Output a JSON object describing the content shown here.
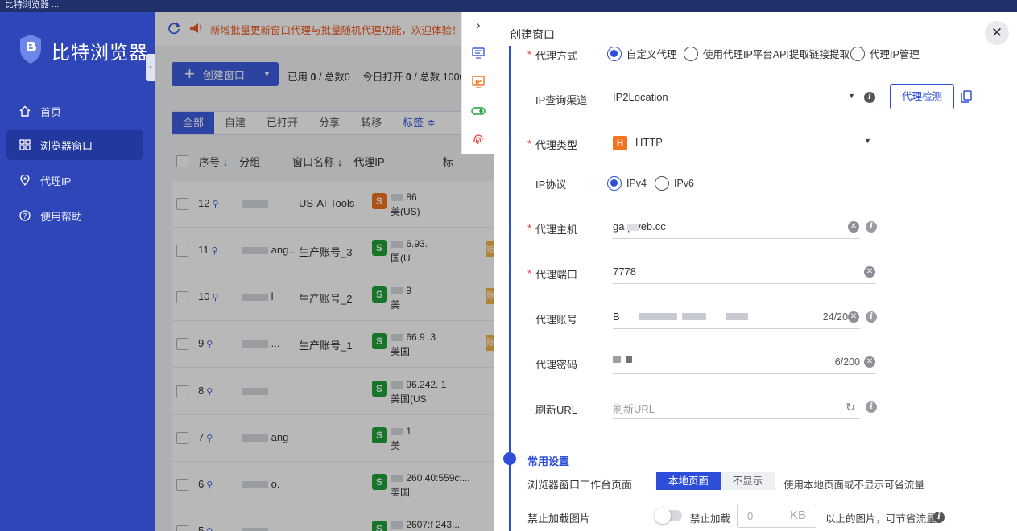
{
  "titlebar": {
    "title": "比特浏览器 ..."
  },
  "sidebar": {
    "brand": "比特浏览器",
    "collapse_glyph": "‹",
    "items": [
      {
        "label": "首页",
        "icon": "home-icon",
        "active": false
      },
      {
        "label": "浏览器窗口",
        "icon": "grid-icon",
        "active": true
      },
      {
        "label": "代理IP",
        "icon": "location-pin-icon",
        "active": false
      },
      {
        "label": "使用帮助",
        "icon": "help-circle-icon",
        "active": false
      }
    ]
  },
  "main": {
    "notice": "新增批量更新窗口代理与批量随机代理功能，欢迎体验！",
    "create_label": "创建窗口",
    "counts": {
      "used_label": "已用",
      "used": "0",
      "total_label": "/ 总数",
      "total": "0",
      "today_label": "今日打开",
      "today": "0",
      "today_total_label": "/ 总数",
      "today_total": "1000"
    },
    "tabs": [
      "全部",
      "自建",
      "已打开",
      "分享",
      "转移",
      "标签"
    ],
    "columns": {
      "seq": "序号",
      "group": "分组",
      "name": "窗口名称",
      "proxy": "代理IP",
      "tag": "标"
    },
    "rows": [
      {
        "seq": "12",
        "group": "",
        "name": "US-AI-Tools",
        "proxy_type": "S",
        "proxy_color": "#f2741e",
        "ip": "86",
        "country": "美(US)",
        "tag": ""
      },
      {
        "seq": "11",
        "group": "ang...",
        "name": "生产账号_3",
        "proxy_type": "S",
        "proxy_color": "#1fa33a",
        "ip": "6.93.",
        "country": "国(U",
        "tag": "账"
      },
      {
        "seq": "10",
        "group": "l",
        "name": "生产账号_2",
        "proxy_type": "S",
        "proxy_color": "#1fa33a",
        "ip": "9",
        "country": "美",
        "tag": "账"
      },
      {
        "seq": "9",
        "group": "...",
        "name": "生产账号_1",
        "proxy_type": "S",
        "proxy_color": "#1fa33a",
        "ip": "66.9 .3",
        "country": "美国",
        "tag": "账"
      },
      {
        "seq": "8",
        "group": "",
        "name": "",
        "proxy_type": "S",
        "proxy_color": "#1fa33a",
        "ip": "96.242. 1",
        "country": "美国(US",
        "tag": ""
      },
      {
        "seq": "7",
        "group": "ang-",
        "name": "",
        "proxy_type": "S",
        "proxy_color": "#1fa33a",
        "ip": "1",
        "country": "美",
        "tag": ""
      },
      {
        "seq": "6",
        "group": "o.",
        "name": "",
        "proxy_type": "S",
        "proxy_color": "#1fa33a",
        "ip": "260 40:559c:...",
        "country": "美国",
        "tag": ""
      },
      {
        "seq": "5",
        "group": "",
        "name": "",
        "proxy_type": "S",
        "proxy_color": "#1fa33a",
        "ip": "2607:f 243...",
        "country": "",
        "tag": ""
      }
    ]
  },
  "panel": {
    "title": "创建窗口",
    "proxy_method": {
      "label": "代理方式",
      "options": [
        "自定义代理",
        "使用代理IP平台API提取链接提取",
        "代理IP管理"
      ],
      "selected": "自定义代理"
    },
    "ip_channel": {
      "label": "IP查询渠道",
      "value": "IP2Location",
      "detect_label": "代理检测"
    },
    "proxy_type": {
      "label": "代理类型",
      "badge": "H",
      "value": "HTTP"
    },
    "ip_protocol": {
      "label": "IP协议",
      "options": [
        "IPv4",
        "IPv6"
      ],
      "selected": "IPv4"
    },
    "host": {
      "label": "代理主机",
      "value": "ga   pweb.cc"
    },
    "port": {
      "label": "代理端口",
      "value": "7778"
    },
    "account": {
      "label": "代理账号",
      "value": "B",
      "counter": "24/200"
    },
    "password": {
      "label": "代理密码",
      "counter": "6/200"
    },
    "refresh_url": {
      "label": "刷新URL",
      "placeholder": "刷新URL"
    },
    "common_settings": "常用设置",
    "workbench": {
      "label": "浏览器窗口工作台页面",
      "options": [
        "本地页面",
        "不显示"
      ],
      "selected": "本地页面",
      "hint": "使用本地页面或不显示可省流量"
    },
    "block_images": {
      "label": "禁止加载图片",
      "toggle_label": "禁止加载",
      "value": "0",
      "unit": "KB",
      "hint": "以上的图片，可节省流量"
    }
  },
  "colors": {
    "sidebar": "#2f46b8",
    "accent": "#2d4ed8",
    "notice": "#f05a23",
    "proxy_green": "#1fa33a",
    "proxy_orange": "#f2741e"
  }
}
